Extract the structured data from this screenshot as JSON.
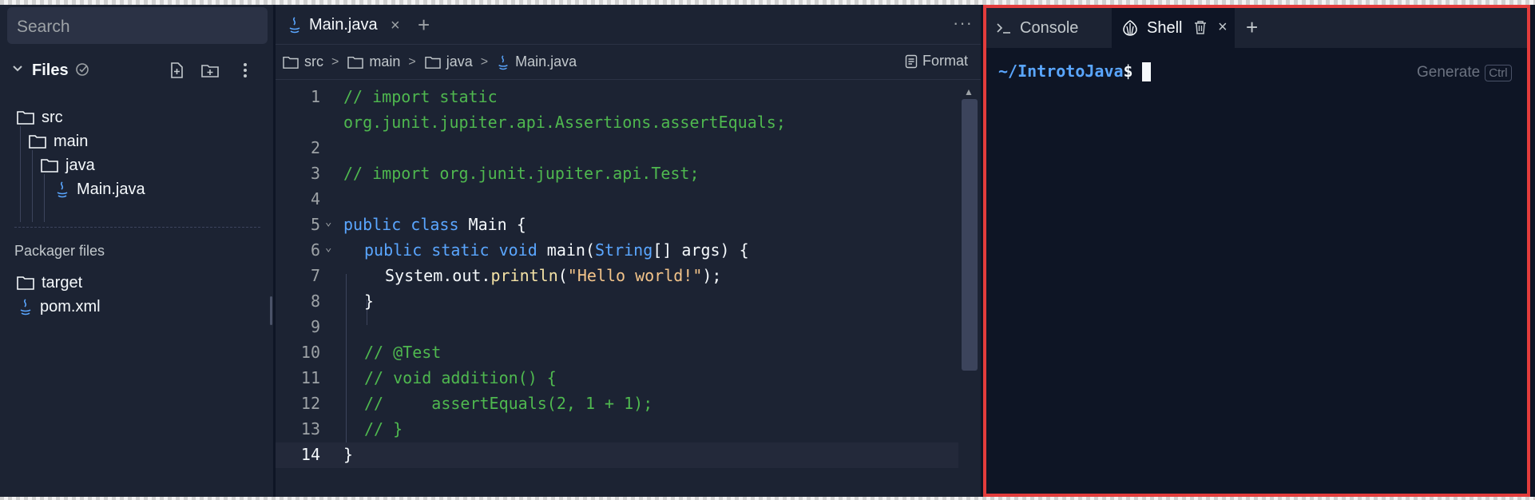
{
  "sidebar": {
    "search_placeholder": "Search",
    "files_title": "Files",
    "tree": [
      {
        "label": "src",
        "type": "folder"
      },
      {
        "label": "main",
        "type": "folder"
      },
      {
        "label": "java",
        "type": "folder"
      },
      {
        "label": "Main.java",
        "type": "java-file"
      }
    ],
    "packager_label": "Packager files",
    "packager_items": [
      {
        "label": "target",
        "type": "folder"
      },
      {
        "label": "pom.xml",
        "type": "java-file"
      }
    ]
  },
  "editor": {
    "tab_label": "Main.java",
    "tab_close": "×",
    "tab_add": "+",
    "more": "···",
    "breadcrumbs": [
      "src",
      "main",
      "java",
      "Main.java"
    ],
    "breadcrumb_sep": ">",
    "format_label": "Format",
    "lines": [
      {
        "n": "1",
        "text": "// import static"
      },
      {
        "n": "",
        "text": "org.junit.jupiter.api.Assertions.assertEquals;"
      },
      {
        "n": "2",
        "text": ""
      },
      {
        "n": "3",
        "text": "// import org.junit.jupiter.api.Test;"
      },
      {
        "n": "4",
        "text": ""
      },
      {
        "n": "5",
        "text": "public class Main {"
      },
      {
        "n": "6",
        "text": "public static void main(String[] args) {"
      },
      {
        "n": "7",
        "text": "System.out.println(\"Hello world!\");"
      },
      {
        "n": "8",
        "text": "}"
      },
      {
        "n": "9",
        "text": ""
      },
      {
        "n": "10",
        "text": "// @Test"
      },
      {
        "n": "11",
        "text": "// void addition() {"
      },
      {
        "n": "12",
        "text": "//     assertEquals(2, 1 + 1);"
      },
      {
        "n": "13",
        "text": "// }"
      },
      {
        "n": "14",
        "text": "}"
      }
    ],
    "fold_marker": "⌄",
    "active_line": "14"
  },
  "right_pane": {
    "tabs": [
      {
        "label": "Console",
        "active": false
      },
      {
        "label": "Shell",
        "active": true
      }
    ],
    "tab_close": "×",
    "tab_add": "+",
    "prompt_path": "~/IntrotoJava",
    "prompt_symbol": "$",
    "generate_label": "Generate",
    "generate_kbd": "Ctrl"
  },
  "colors": {
    "background": "#0e1525",
    "panel": "#1c2333",
    "accent_blue": "#5aa6ff",
    "comment_green": "#4fb84f",
    "string_orange": "#f3c48a",
    "highlight_border": "#e23c3c"
  }
}
